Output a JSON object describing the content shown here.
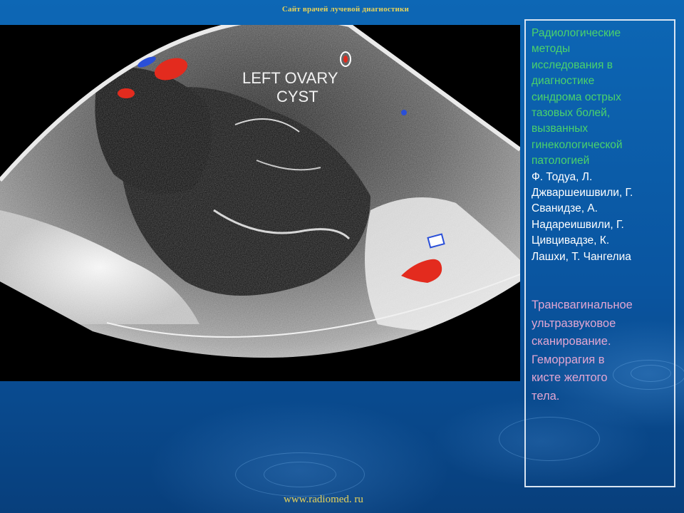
{
  "header": {
    "site_title": "Сайт врачей лучевой диагностики"
  },
  "ultrasound": {
    "overlay_line1": "LEFT OVARY",
    "overlay_line2": "CYST",
    "doppler_colors": {
      "red": "#e32b1e",
      "blue": "#2a4fd8",
      "white": "#ffffff"
    }
  },
  "sidebar": {
    "title": "Радиологические\nметоды\nисследования в\nдиагностике\nсиндрома острых\nтазовых болей,\nвызванных\nгинекологической\nпатологией",
    "authors": "Ф. Тодуа, Л.\nДжваршеишвили, Г.\nСванидзе, А.\nНадареишвили, Г.\nЦивцивадзе, К.\nЛашхи, Т. Чангелиа",
    "caption": "Трансвагинальное\nультразвуковое\nсканирование.\nГеморрагия в\nкисте желтого\nтела."
  },
  "footer": {
    "url": "www.radiomed. ru"
  },
  "colors": {
    "title_green": "#4bd36b",
    "caption_pink": "#e2a6d2",
    "header_yellow": "#e6d25a",
    "background_blue": "#0a55a0"
  }
}
